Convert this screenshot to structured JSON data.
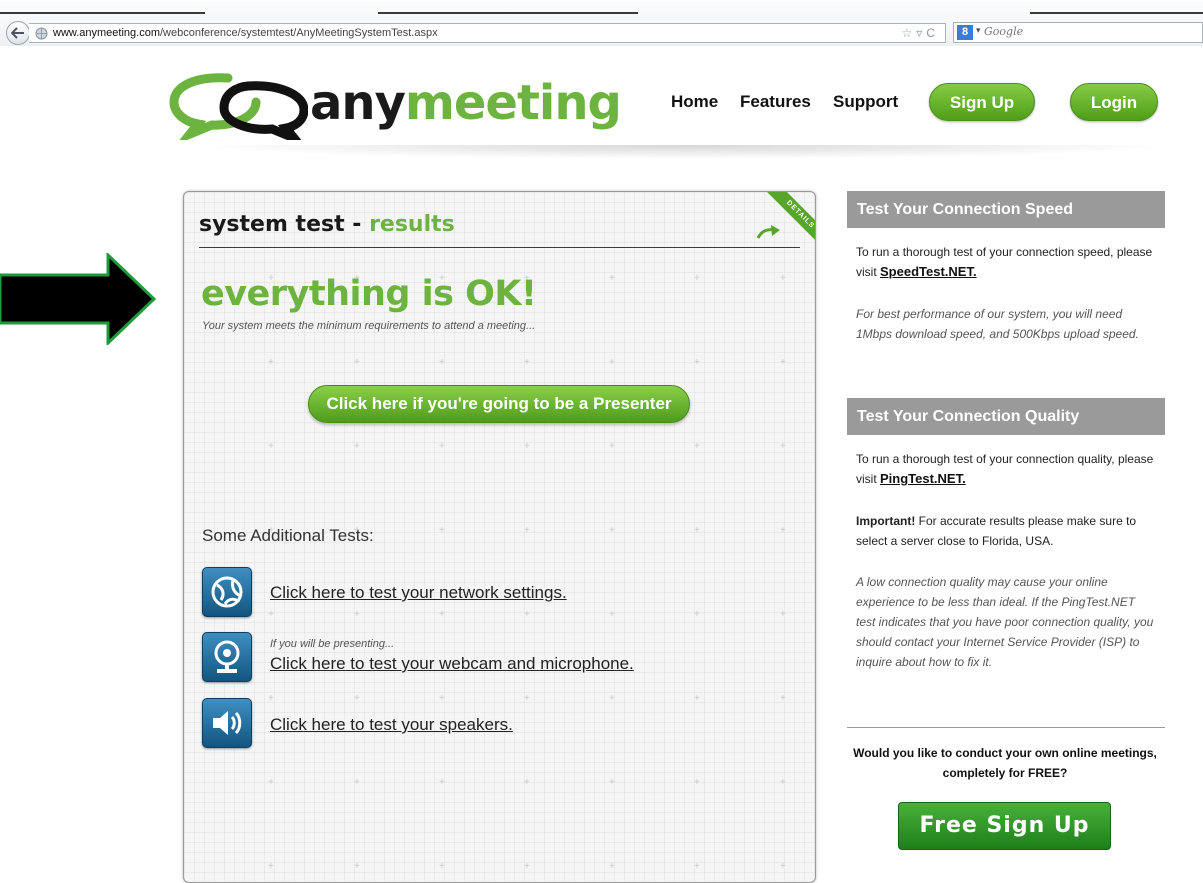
{
  "browser": {
    "url_domain": "www.anymeeting.com",
    "url_path": "/webconference/systemtest/AnyMeetingSystemTest.aspx",
    "search_engine": "Google",
    "search_engine_badge": "8"
  },
  "header": {
    "logo_any": "any",
    "logo_meeting": "meeting",
    "nav": [
      "Home",
      "Features",
      "Support"
    ],
    "signup_label": "Sign Up",
    "login_label": "Login",
    "accent_color": "#6db33f"
  },
  "panel": {
    "title_main": "system test",
    "title_sep": " - ",
    "title_accent": "results",
    "ribbon_label": "DETAILS",
    "status_heading": "everything is OK!",
    "status_sub": "Your system meets the minimum requirements to attend a meeting...",
    "presenter_button": "Click here if you're going to be a Presenter",
    "additional_heading": "Some Additional Tests:",
    "tests": [
      {
        "icon": "network-icon",
        "label": "Click here to test your network settings."
      },
      {
        "icon": "webcam-icon",
        "note": "If you will be presenting...",
        "label": "Click here to test your webcam and microphone."
      },
      {
        "icon": "speaker-icon",
        "label": "Click here to test your speakers."
      }
    ]
  },
  "sidebar": {
    "speed": {
      "heading": "Test Your Connection Speed",
      "intro": "To run a thorough test of your connection speed, please visit ",
      "link": "SpeedTest.NET.",
      "note": "For best performance of our system, you will need 1Mbps download speed, and 500Kbps upload speed."
    },
    "quality": {
      "heading": "Test Your Connection Quality",
      "intro": "To run a thorough test of your connection quality, please visit ",
      "link": "PingTest.NET.",
      "important_label": "Important!",
      "important_text": " For accurate results please make sure to select a server close to Florida, USA.",
      "note": "A low connection quality may cause your online experience to be less than ideal. If the PingTest.NET test indicates that you have poor connection quality, you should contact your Internet Service Provider (ISP) to inquire about how to fix it."
    },
    "cta_text": "Would you like to conduct your own online meetings, completely for FREE?",
    "free_signup_label": "Free Sign Up"
  }
}
